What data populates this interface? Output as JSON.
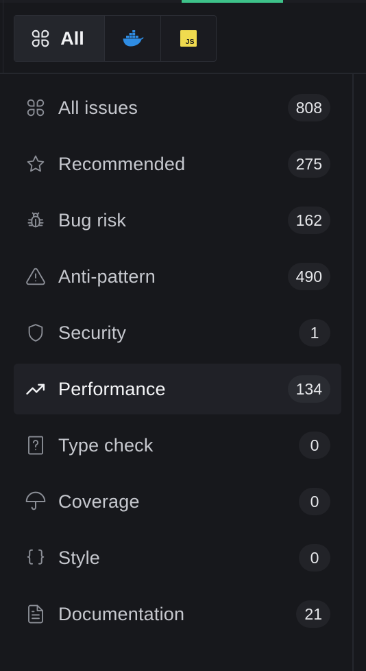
{
  "filters": {
    "all_label": "All",
    "docker_icon": "docker-icon",
    "js_icon": "javascript-icon",
    "js_badge_text": "JS"
  },
  "colors": {
    "accent": "#3ec28a",
    "background": "#17181c",
    "active_row": "#202127",
    "docker_blue": "#2f8de4",
    "js_yellow": "#f0db4f"
  },
  "issues": [
    {
      "label": "All issues",
      "count": "808",
      "icon": "grid-icon",
      "active": false
    },
    {
      "label": "Recommended",
      "count": "275",
      "icon": "star-icon",
      "active": false
    },
    {
      "label": "Bug risk",
      "count": "162",
      "icon": "bug-icon",
      "active": false
    },
    {
      "label": "Anti-pattern",
      "count": "490",
      "icon": "warning-icon",
      "active": false
    },
    {
      "label": "Security",
      "count": "1",
      "icon": "shield-icon",
      "active": false
    },
    {
      "label": "Performance",
      "count": "134",
      "icon": "trending-up-icon",
      "active": true
    },
    {
      "label": "Type check",
      "count": "0",
      "icon": "question-file-icon",
      "active": false
    },
    {
      "label": "Coverage",
      "count": "0",
      "icon": "umbrella-icon",
      "active": false
    },
    {
      "label": "Style",
      "count": "0",
      "icon": "braces-icon",
      "active": false
    },
    {
      "label": "Documentation",
      "count": "21",
      "icon": "document-icon",
      "active": false
    }
  ]
}
